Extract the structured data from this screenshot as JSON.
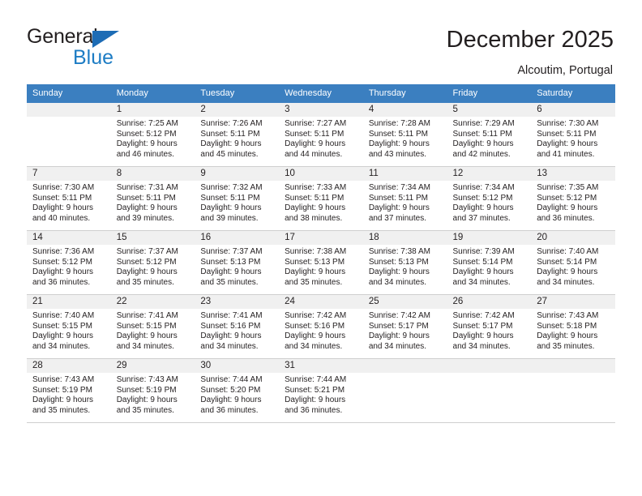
{
  "brand": {
    "name_part1": "General",
    "name_part2": "Blue",
    "triangle_icon": "blue-triangle-icon",
    "accent_color": "#1d7cc4",
    "header_color": "#3b7fc0"
  },
  "header": {
    "title": "December 2025",
    "subtitle": "Alcoutim, Portugal"
  },
  "weekday_headers": [
    "Sunday",
    "Monday",
    "Tuesday",
    "Wednesday",
    "Thursday",
    "Friday",
    "Saturday"
  ],
  "labels": {
    "sunrise_prefix": "Sunrise:",
    "sunset_prefix": "Sunset:",
    "daylight_prefix": "Daylight:"
  },
  "weeks": [
    [
      {
        "day": "",
        "line1": "",
        "line2": "",
        "line3": "",
        "line4": ""
      },
      {
        "day": "1",
        "line1": "Sunrise: 7:25 AM",
        "line2": "Sunset: 5:12 PM",
        "line3": "Daylight: 9 hours",
        "line4": "and 46 minutes."
      },
      {
        "day": "2",
        "line1": "Sunrise: 7:26 AM",
        "line2": "Sunset: 5:11 PM",
        "line3": "Daylight: 9 hours",
        "line4": "and 45 minutes."
      },
      {
        "day": "3",
        "line1": "Sunrise: 7:27 AM",
        "line2": "Sunset: 5:11 PM",
        "line3": "Daylight: 9 hours",
        "line4": "and 44 minutes."
      },
      {
        "day": "4",
        "line1": "Sunrise: 7:28 AM",
        "line2": "Sunset: 5:11 PM",
        "line3": "Daylight: 9 hours",
        "line4": "and 43 minutes."
      },
      {
        "day": "5",
        "line1": "Sunrise: 7:29 AM",
        "line2": "Sunset: 5:11 PM",
        "line3": "Daylight: 9 hours",
        "line4": "and 42 minutes."
      },
      {
        "day": "6",
        "line1": "Sunrise: 7:30 AM",
        "line2": "Sunset: 5:11 PM",
        "line3": "Daylight: 9 hours",
        "line4": "and 41 minutes."
      }
    ],
    [
      {
        "day": "7",
        "line1": "Sunrise: 7:30 AM",
        "line2": "Sunset: 5:11 PM",
        "line3": "Daylight: 9 hours",
        "line4": "and 40 minutes."
      },
      {
        "day": "8",
        "line1": "Sunrise: 7:31 AM",
        "line2": "Sunset: 5:11 PM",
        "line3": "Daylight: 9 hours",
        "line4": "and 39 minutes."
      },
      {
        "day": "9",
        "line1": "Sunrise: 7:32 AM",
        "line2": "Sunset: 5:11 PM",
        "line3": "Daylight: 9 hours",
        "line4": "and 39 minutes."
      },
      {
        "day": "10",
        "line1": "Sunrise: 7:33 AM",
        "line2": "Sunset: 5:11 PM",
        "line3": "Daylight: 9 hours",
        "line4": "and 38 minutes."
      },
      {
        "day": "11",
        "line1": "Sunrise: 7:34 AM",
        "line2": "Sunset: 5:11 PM",
        "line3": "Daylight: 9 hours",
        "line4": "and 37 minutes."
      },
      {
        "day": "12",
        "line1": "Sunrise: 7:34 AM",
        "line2": "Sunset: 5:12 PM",
        "line3": "Daylight: 9 hours",
        "line4": "and 37 minutes."
      },
      {
        "day": "13",
        "line1": "Sunrise: 7:35 AM",
        "line2": "Sunset: 5:12 PM",
        "line3": "Daylight: 9 hours",
        "line4": "and 36 minutes."
      }
    ],
    [
      {
        "day": "14",
        "line1": "Sunrise: 7:36 AM",
        "line2": "Sunset: 5:12 PM",
        "line3": "Daylight: 9 hours",
        "line4": "and 36 minutes."
      },
      {
        "day": "15",
        "line1": "Sunrise: 7:37 AM",
        "line2": "Sunset: 5:12 PM",
        "line3": "Daylight: 9 hours",
        "line4": "and 35 minutes."
      },
      {
        "day": "16",
        "line1": "Sunrise: 7:37 AM",
        "line2": "Sunset: 5:13 PM",
        "line3": "Daylight: 9 hours",
        "line4": "and 35 minutes."
      },
      {
        "day": "17",
        "line1": "Sunrise: 7:38 AM",
        "line2": "Sunset: 5:13 PM",
        "line3": "Daylight: 9 hours",
        "line4": "and 35 minutes."
      },
      {
        "day": "18",
        "line1": "Sunrise: 7:38 AM",
        "line2": "Sunset: 5:13 PM",
        "line3": "Daylight: 9 hours",
        "line4": "and 34 minutes."
      },
      {
        "day": "19",
        "line1": "Sunrise: 7:39 AM",
        "line2": "Sunset: 5:14 PM",
        "line3": "Daylight: 9 hours",
        "line4": "and 34 minutes."
      },
      {
        "day": "20",
        "line1": "Sunrise: 7:40 AM",
        "line2": "Sunset: 5:14 PM",
        "line3": "Daylight: 9 hours",
        "line4": "and 34 minutes."
      }
    ],
    [
      {
        "day": "21",
        "line1": "Sunrise: 7:40 AM",
        "line2": "Sunset: 5:15 PM",
        "line3": "Daylight: 9 hours",
        "line4": "and 34 minutes."
      },
      {
        "day": "22",
        "line1": "Sunrise: 7:41 AM",
        "line2": "Sunset: 5:15 PM",
        "line3": "Daylight: 9 hours",
        "line4": "and 34 minutes."
      },
      {
        "day": "23",
        "line1": "Sunrise: 7:41 AM",
        "line2": "Sunset: 5:16 PM",
        "line3": "Daylight: 9 hours",
        "line4": "and 34 minutes."
      },
      {
        "day": "24",
        "line1": "Sunrise: 7:42 AM",
        "line2": "Sunset: 5:16 PM",
        "line3": "Daylight: 9 hours",
        "line4": "and 34 minutes."
      },
      {
        "day": "25",
        "line1": "Sunrise: 7:42 AM",
        "line2": "Sunset: 5:17 PM",
        "line3": "Daylight: 9 hours",
        "line4": "and 34 minutes."
      },
      {
        "day": "26",
        "line1": "Sunrise: 7:42 AM",
        "line2": "Sunset: 5:17 PM",
        "line3": "Daylight: 9 hours",
        "line4": "and 34 minutes."
      },
      {
        "day": "27",
        "line1": "Sunrise: 7:43 AM",
        "line2": "Sunset: 5:18 PM",
        "line3": "Daylight: 9 hours",
        "line4": "and 35 minutes."
      }
    ],
    [
      {
        "day": "28",
        "line1": "Sunrise: 7:43 AM",
        "line2": "Sunset: 5:19 PM",
        "line3": "Daylight: 9 hours",
        "line4": "and 35 minutes."
      },
      {
        "day": "29",
        "line1": "Sunrise: 7:43 AM",
        "line2": "Sunset: 5:19 PM",
        "line3": "Daylight: 9 hours",
        "line4": "and 35 minutes."
      },
      {
        "day": "30",
        "line1": "Sunrise: 7:44 AM",
        "line2": "Sunset: 5:20 PM",
        "line3": "Daylight: 9 hours",
        "line4": "and 36 minutes."
      },
      {
        "day": "31",
        "line1": "Sunrise: 7:44 AM",
        "line2": "Sunset: 5:21 PM",
        "line3": "Daylight: 9 hours",
        "line4": "and 36 minutes."
      },
      {
        "day": "",
        "line1": "",
        "line2": "",
        "line3": "",
        "line4": ""
      },
      {
        "day": "",
        "line1": "",
        "line2": "",
        "line3": "",
        "line4": ""
      },
      {
        "day": "",
        "line1": "",
        "line2": "",
        "line3": "",
        "line4": ""
      }
    ]
  ]
}
